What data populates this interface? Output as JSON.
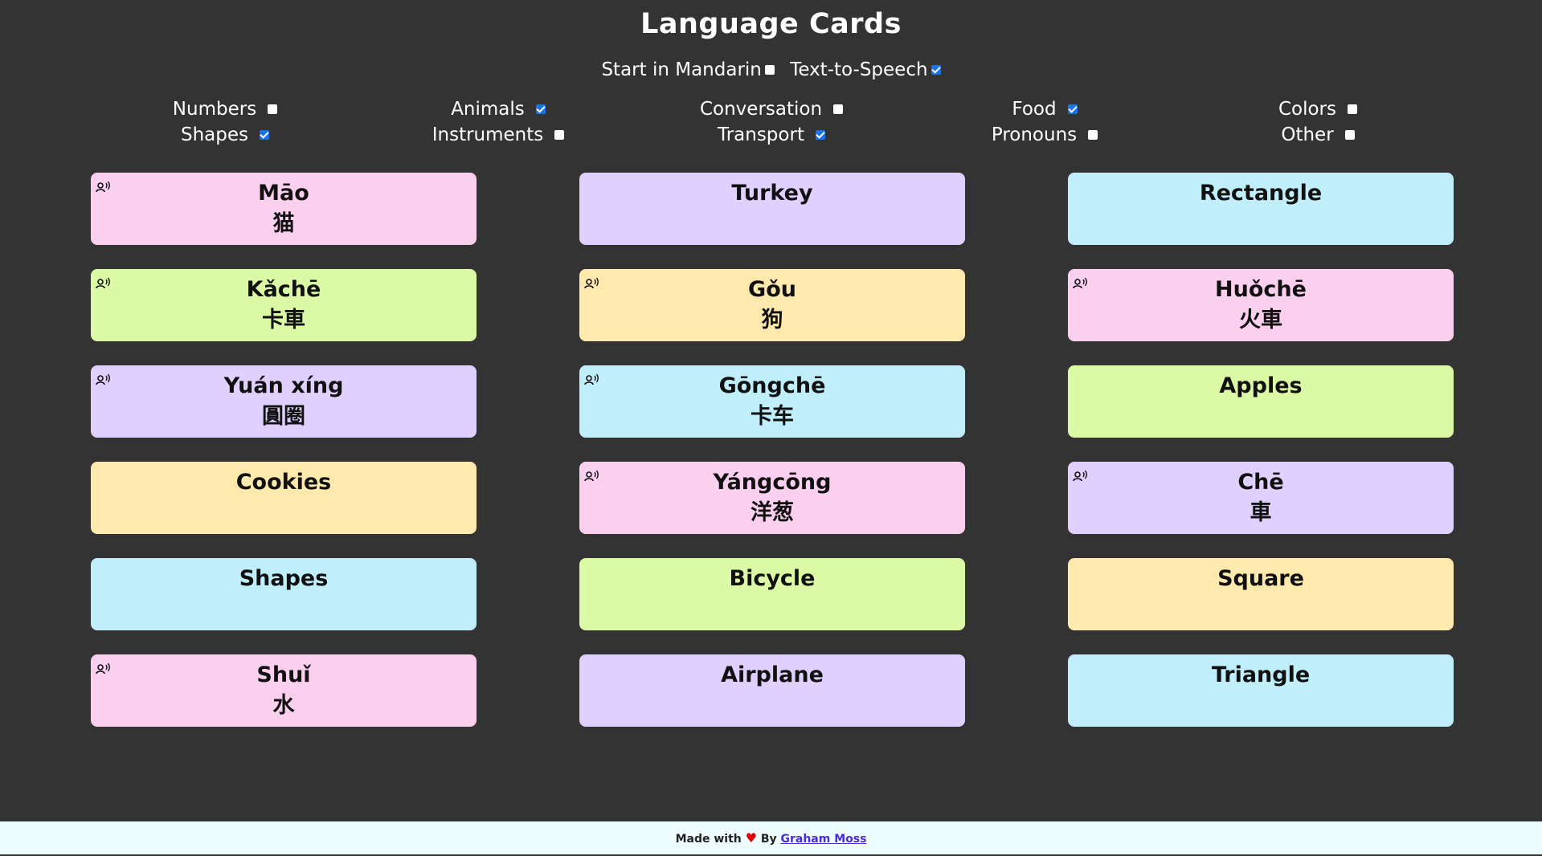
{
  "header": {
    "title": "Language Cards"
  },
  "options": {
    "start_mandarin": {
      "label": "Start in Mandarin",
      "checked": false
    },
    "tts": {
      "label": "Text-to-Speech",
      "checked": true
    }
  },
  "categories": [
    [
      {
        "label": "Numbers",
        "checked": false
      },
      {
        "label": "Shapes",
        "checked": true
      }
    ],
    [
      {
        "label": "Animals",
        "checked": true
      },
      {
        "label": "Instruments",
        "checked": false
      }
    ],
    [
      {
        "label": "Conversation",
        "checked": false
      },
      {
        "label": "Transport",
        "checked": true
      }
    ],
    [
      {
        "label": "Food",
        "checked": true
      },
      {
        "label": "Pronouns",
        "checked": false
      }
    ],
    [
      {
        "label": "Colors",
        "checked": false
      },
      {
        "label": "Other",
        "checked": false
      }
    ]
  ],
  "cards": [
    {
      "text": "Māo",
      "hanzi": "猫",
      "color": "pink",
      "speaker": true
    },
    {
      "text": "Turkey",
      "hanzi": "",
      "color": "violet",
      "speaker": false
    },
    {
      "text": "Rectangle",
      "hanzi": "",
      "color": "cyan",
      "speaker": false
    },
    {
      "text": "Kǎchē",
      "hanzi": "卡車",
      "color": "lime",
      "speaker": true
    },
    {
      "text": "Gǒu",
      "hanzi": "狗",
      "color": "yellow",
      "speaker": true
    },
    {
      "text": "Huǒchē",
      "hanzi": "火車",
      "color": "pink",
      "speaker": true
    },
    {
      "text": "Yuán xíng",
      "hanzi": "圓圈",
      "color": "violet",
      "speaker": true
    },
    {
      "text": "Gōngchē",
      "hanzi": "卡车",
      "color": "cyan",
      "speaker": true
    },
    {
      "text": "Apples",
      "hanzi": "",
      "color": "lime",
      "speaker": false
    },
    {
      "text": "Cookies",
      "hanzi": "",
      "color": "yellow",
      "speaker": false
    },
    {
      "text": "Yángcōng",
      "hanzi": "洋葱",
      "color": "pink",
      "speaker": true
    },
    {
      "text": "Chē",
      "hanzi": "車",
      "color": "violet",
      "speaker": true
    },
    {
      "text": "Shapes",
      "hanzi": "",
      "color": "cyan",
      "speaker": false
    },
    {
      "text": "Bicycle",
      "hanzi": "",
      "color": "lime",
      "speaker": false
    },
    {
      "text": "Square",
      "hanzi": "",
      "color": "yellow",
      "speaker": false
    },
    {
      "text": "Shuǐ",
      "hanzi": "水",
      "color": "pink",
      "speaker": true
    },
    {
      "text": "Airplane",
      "hanzi": "",
      "color": "violet",
      "speaker": false
    },
    {
      "text": "Triangle",
      "hanzi": "",
      "color": "cyan",
      "speaker": false
    }
  ],
  "footer": {
    "made_with": "Made with",
    "by": "By",
    "author": "Graham Moss"
  }
}
